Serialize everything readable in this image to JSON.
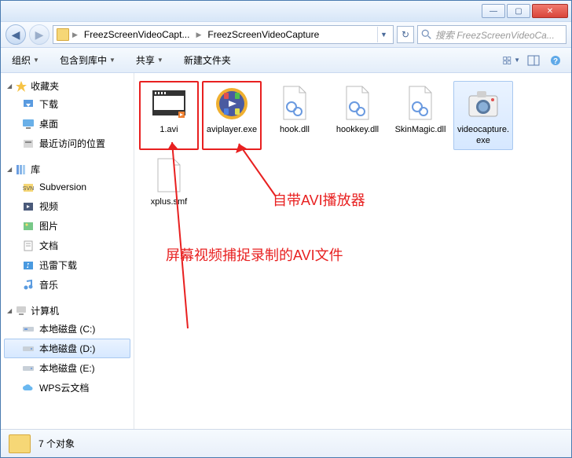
{
  "titlebar": {
    "minimize": "—",
    "maximize": "▢",
    "close": "✕"
  },
  "nav": {
    "back": "◀",
    "forward": "▶",
    "path_parent": "FreezScreenVideoCapt...",
    "path_current": "FreezScreenVideoCapture",
    "refresh": "↻",
    "search_placeholder": "搜索 FreezScreenVideoCa..."
  },
  "toolbar": {
    "organize": "组织",
    "include": "包含到库中",
    "share": "共享",
    "newfolder": "新建文件夹"
  },
  "sidebar": {
    "favorites": {
      "head": "收藏夹",
      "downloads": "下载",
      "desktop": "桌面",
      "recent": "最近访问的位置"
    },
    "libraries": {
      "head": "库",
      "subversion": "Subversion",
      "videos": "视频",
      "pictures": "图片",
      "documents": "文档",
      "xunlei": "迅雷下载",
      "music": "音乐"
    },
    "computer": {
      "head": "计算机",
      "c": "本地磁盘 (C:)",
      "d": "本地磁盘 (D:)",
      "e": "本地磁盘 (E:)",
      "wps": "WPS云文档"
    }
  },
  "files": {
    "f0": "1.avi",
    "f1": "aviplayer.exe",
    "f2": "hook.dll",
    "f3": "hookkey.dll",
    "f4": "SkinMagic.dll",
    "f5": "videocapture.exe",
    "f6": "xplus.smf"
  },
  "status": {
    "count": "7 个对象"
  },
  "annotations": {
    "a1": "自带AVI播放器",
    "a2": "屏幕视频捕捉录制的AVI文件"
  }
}
